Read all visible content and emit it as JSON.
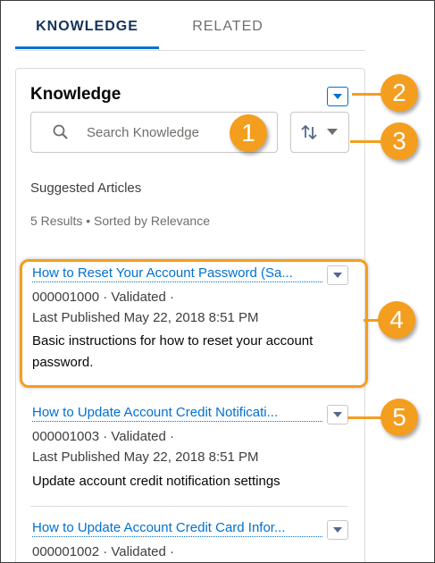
{
  "tabs": [
    {
      "label": "KNOWLEDGE",
      "active": true
    },
    {
      "label": "RELATED",
      "active": false
    }
  ],
  "card": {
    "title": "Knowledge",
    "search_placeholder": "Search Knowledge",
    "suggested_label": "Suggested Articles",
    "results_summary": "5 Results • Sorted by Relevance"
  },
  "articles": [
    {
      "title": "How to Reset Your Account Password (Sa...",
      "number_status": "000001000  ·  Validated  ·",
      "published": "Last Published  May 22, 2018 8:51 PM",
      "summary": "Basic instructions for how to reset your account password."
    },
    {
      "title": "How to Update Account Credit Notificati...",
      "number_status": "000001003  ·  Validated  ·",
      "published": "Last Published  May 22, 2018 8:51 PM",
      "summary": "Update account credit notification settings"
    },
    {
      "title": "How to Update Account Credit Card Infor...",
      "number_status": "000001002  ·  Validated  ·"
    }
  ],
  "callouts": [
    "1",
    "2",
    "3",
    "4",
    "5"
  ],
  "colors": {
    "accent": "#0070d2",
    "callout": "#f49e1f"
  }
}
